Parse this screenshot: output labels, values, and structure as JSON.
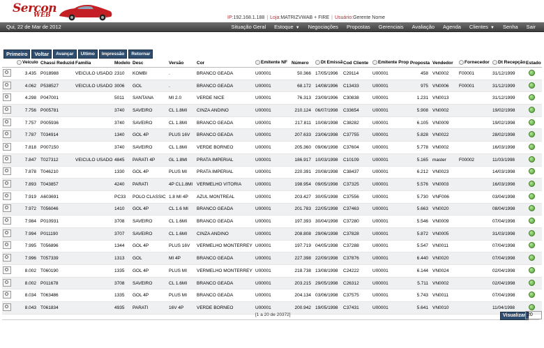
{
  "app": {
    "logo_main": "Sercon",
    "logo_sub": "WEB"
  },
  "session": {
    "ip_label": "IP:",
    "ip_value": "192.168.1.188",
    "loja_label": "Loja:",
    "loja_value": "MATRIZVWAB + FIRE",
    "usuario_label": "Usuário:",
    "usuario_value": "Gerente Nome"
  },
  "nav": {
    "date": "Qui, 22 de Mar de 2012",
    "menu": [
      {
        "label": "Situação Geral",
        "has_dropdown": false
      },
      {
        "label": "Estoque",
        "has_dropdown": true
      },
      {
        "label": "Negociações",
        "has_dropdown": false
      },
      {
        "label": "Propostas",
        "has_dropdown": false
      },
      {
        "label": "Gerenciais",
        "has_dropdown": false
      },
      {
        "label": "Avaliação",
        "has_dropdown": false
      },
      {
        "label": "Agenda",
        "has_dropdown": false
      },
      {
        "label": "Clientes",
        "has_dropdown": true
      },
      {
        "label": "Senha",
        "has_dropdown": false
      },
      {
        "label": "Sair",
        "has_dropdown": false
      }
    ]
  },
  "toolbar": {
    "primeiro": "Primeiro",
    "voltar": "Voltar",
    "avancar": "Avançar",
    "ultimo": "Ultimo",
    "impressao": "Impressão",
    "retornar": "Retornar"
  },
  "table": {
    "headers": [
      "",
      "Veículo",
      "Chassi Reduzido",
      "Família",
      "Modelo",
      "Desc",
      "Versão",
      "Cor",
      "Emitente NF",
      "Número",
      "Dt Emissão",
      "Cod Cliente",
      "Emitente Prop",
      "Proposta",
      "Vendedor",
      "Fornecedor",
      "Dt Recepção",
      "Estado"
    ],
    "rows": [
      [
        "3.435",
        "P018988",
        "VEICULO USADO",
        "2310",
        "KOMBI",
        ".",
        "BRANCO GEADA",
        "U00001",
        "50.366",
        "17/05/1996",
        "C29114",
        "U00001",
        "458",
        "VN0002",
        "F00001",
        "31/12/1999"
      ],
      [
        "4.062",
        "P538527",
        "VEICULO USADO",
        "3006",
        "GOL",
        ".",
        "BRANCO GEADA",
        "U00001",
        "68.172",
        "14/08/1996",
        "C13433",
        "U00001",
        "975",
        "VN0006",
        "F00001",
        "31/12/1999"
      ],
      [
        "4.298",
        "P047001",
        "",
        "5011",
        "SANTANA",
        "MI 2.0",
        "VERDE NICE",
        "U00001",
        "76.313",
        "23/09/1996",
        "C30838",
        "U00001",
        "1.231",
        "VN0013",
        "",
        "31/12/1999"
      ],
      [
        "7.756",
        "P005781",
        "",
        "3740",
        "SAVEIRO",
        "CL 1.8MI",
        "CINZA ANDINO",
        "U00001",
        "210.124",
        "06/07/1998",
        "C33654",
        "U00001",
        "5.908",
        "VN0002",
        "",
        "19/02/1998"
      ],
      [
        "7.757",
        "P005936",
        "",
        "3740",
        "SAVEIRO",
        "CL 1.8MI",
        "BRANCO GEADA",
        "U00001",
        "217.811",
        "10/08/1998",
        "C38282",
        "U00001",
        "6.105",
        "VN0009",
        "",
        "19/02/1998"
      ],
      [
        "7.787",
        "T034914",
        "",
        "1340",
        "GOL 4P",
        "PLUS 16V",
        "BRANCO GEADA",
        "U00001",
        "207.633",
        "23/06/1998",
        "C37755",
        "U00001",
        "5.828",
        "VN0022",
        "",
        "28/02/1998"
      ],
      [
        "7.818",
        "P007150",
        "",
        "3740",
        "SAVEIRO",
        "CL 1.8MI",
        "VERDE BORNEO",
        "U00001",
        "205.360",
        "09/06/1998",
        "C37604",
        "U00001",
        "5.778",
        "VN0002",
        "",
        "16/03/1998"
      ],
      [
        "7.847",
        "T027312",
        "VEICULO USADO",
        "4845",
        "PARATI 4P",
        "GL 1.8MI",
        "PRATA IMPERIAL",
        "U00001",
        "186.917",
        "10/03/1998",
        "C10109",
        "U00001",
        "5.165",
        "master",
        "F00002",
        "11/03/1998"
      ],
      [
        "7.878",
        "T046210",
        "",
        "1330",
        "GOL 4P",
        "PLUS MI",
        "PRATA IMPERIAL",
        "U00001",
        "220.391",
        "20/08/1998",
        "C38437",
        "U00001",
        "6.212",
        "VN0023",
        "",
        "14/03/1998"
      ],
      [
        "7.893",
        "T043857",
        "",
        "4240",
        "PARATI",
        "4P CL1.8MI",
        "VERMELHO VITORIA",
        "U00001",
        "198.954",
        "09/05/1998",
        "C37325",
        "U00001",
        "5.576",
        "VN0003",
        "",
        "16/03/1998"
      ],
      [
        "7.919",
        "A603691",
        "",
        "PC33",
        "POLO CLASSIC",
        "1.8 MI 4P",
        "AZUL MONTREAL",
        "U00001",
        "203.427",
        "30/05/1998",
        "C37556",
        "U00001",
        "5.730",
        "VNF006",
        "",
        "03/04/1998"
      ],
      [
        "7.972",
        "T056046",
        "",
        "1410",
        "GOL 4P",
        "CL 1.6 MI",
        "BRANCO GEADA",
        "U00001",
        "201.783",
        "22/05/1998",
        "C37463",
        "U00001",
        "5.663",
        "VN0020",
        "",
        "08/04/1998"
      ],
      [
        "7.984",
        "P010931",
        "",
        "3708",
        "SAVEIRO",
        "CL 1.6MI",
        "BRANCO GEADA",
        "U00001",
        "197.393",
        "30/04/1998",
        "C37280",
        "U00001",
        "5.546",
        "VN0009",
        "",
        "07/04/1998"
      ],
      [
        "7.994",
        "P011190",
        "",
        "3707",
        "SAVEIRO",
        "CL 1.6MI",
        "CINZA ANDINO",
        "U00001",
        "208.808",
        "29/06/1998",
        "C37828",
        "U00001",
        "5.872",
        "VN0005",
        "",
        "31/03/1998"
      ],
      [
        "7.995",
        "T056896",
        "",
        "1344",
        "GOL 4P",
        "PLUS 16V",
        "VERMELHO MONTERREY",
        "U00001",
        "197.719",
        "04/05/1998",
        "C37288",
        "U00001",
        "5.547",
        "VN0011",
        "",
        "07/04/1998"
      ],
      [
        "7.996",
        "T057339",
        "",
        "1313",
        "GOL",
        "MI 4P",
        "BRANCO GEADA",
        "U00001",
        "227.398",
        "22/09/1998",
        "C37876",
        "U00001",
        "6.440",
        "VN0020",
        "",
        "07/04/1998"
      ],
      [
        "8.002",
        "T060190",
        "",
        "1335",
        "GOL 4P",
        "PLUS MI",
        "VERMELHO MONTERREY",
        "U00001",
        "218.738",
        "13/08/1998",
        "C24222",
        "U00001",
        "6.144",
        "VN0024",
        "",
        "02/04/1998"
      ],
      [
        "8.002",
        "P011678",
        "",
        "3708",
        "SAVEIRO",
        "CL 1.6MI",
        "BRANCO GEADA",
        "U00001",
        "203.215",
        "29/05/1998",
        "C26312",
        "U00001",
        "5.711",
        "VN0002",
        "",
        "02/04/1998"
      ],
      [
        "8.034",
        "T063486",
        "",
        "1335",
        "GOL 4P",
        "PLUS MI",
        "BRANCO GEADA",
        "U00001",
        "204.134",
        "03/06/1998",
        "C37575",
        "U00001",
        "5.743",
        "VN0011",
        "",
        "07/04/1998"
      ],
      [
        "8.043",
        "T061834",
        "",
        "4935",
        "PARATI",
        "16V 4P",
        "VERDE BORNEO",
        "U00001",
        "200.942",
        "19/05/1998",
        "C37431",
        "U00001",
        "5.641",
        "VN0010",
        "",
        "11/04/1998"
      ]
    ]
  },
  "footer": {
    "record_count": "[1 a 20 de 20372]",
    "visualizar": "Visualizar",
    "page_size": "20"
  },
  "colors": {
    "brand_red": "#b81a1a",
    "nav_bg": "#4e4e4e",
    "button_bg": "#2f4d6e",
    "status_green": "#4d9b2d"
  }
}
